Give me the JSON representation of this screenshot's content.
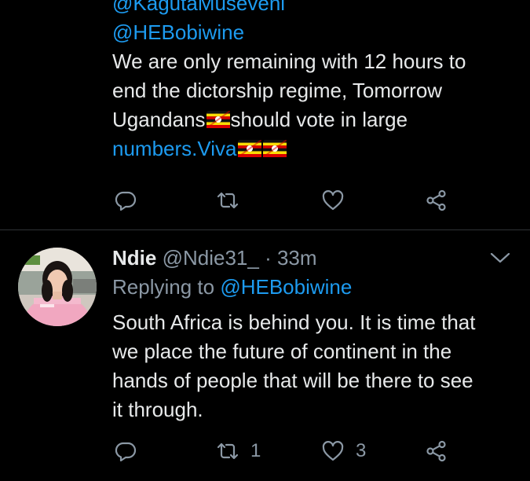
{
  "colors": {
    "background": "#000000",
    "text": "#e7e9ea",
    "secondary": "#8b98a5",
    "link": "#1d9bf0",
    "divider": "#2f3336"
  },
  "tweet1": {
    "mention1": "@KagutaMuseveni",
    "mention2": "@HEBobiwine",
    "line1": "We are only remaining with 12 hours to",
    "line2": "end the dictorship regime, Tomorrow",
    "line3_a": "Ugandans",
    "line3_b": "should vote in large",
    "line4_link": "numbers.Viva",
    "flag_icon": "uganda-flag-emoji",
    "actions": {
      "reply_icon": "reply-icon",
      "retweet_icon": "retweet-icon",
      "like_icon": "heart-icon",
      "share_icon": "share-icon"
    }
  },
  "tweet2": {
    "name": "Ndie",
    "handle": "@Ndie31_",
    "dot": "·",
    "time": "33m",
    "replying_prefix": "Replying to",
    "replying_to": "@HEBobiwine",
    "text_lines": [
      "South Africa is behind you. It is time that",
      "we place the future of continent in the",
      "hands of people that will be there to see",
      "it through."
    ],
    "retweet_count": "1",
    "like_count": "3",
    "actions": {
      "reply_icon": "reply-icon",
      "retweet_icon": "retweet-icon",
      "like_icon": "heart-icon",
      "share_icon": "share-icon",
      "more_icon": "chevron-down-icon"
    }
  }
}
